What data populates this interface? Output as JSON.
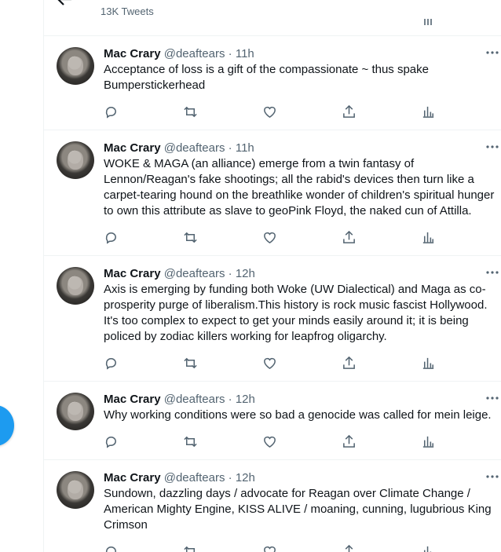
{
  "header": {
    "tweet_count": "13K Tweets"
  },
  "tweets": [
    {
      "name": "Mac Crary",
      "handle": "@deaftears",
      "separator": "·",
      "time": "11h",
      "text": "Acceptance of loss is a gift of the compassionate ~ thus spake\nBumperstickerhead"
    },
    {
      "name": "Mac Crary",
      "handle": "@deaftears",
      "separator": "·",
      "time": "11h",
      "text": "WOKE & MAGA (an alliance) emerge from a twin fantasy of\nLennon/Reagan's fake shootings; all the rabid's devices then turn like a\ncarpet-tearing hound on the breathlike wonder of children's spiritual hunger\nto own this attribute as slave to geoPink Floyd, the naked cun of Attilla."
    },
    {
      "name": "Mac Crary",
      "handle": "@deaftears",
      "separator": "·",
      "time": "12h",
      "text": "Axis is emerging by funding both Woke (UW Dialectical) and Maga as co-\nprosperity purge of liberalism.This history is rock music fascist Hollywood.\nIt's too complex to expect to get your minds easily around it; it is being\npoliced by zodiac killers working for leapfrog oligarchy."
    },
    {
      "name": "Mac Crary",
      "handle": "@deaftears",
      "separator": "·",
      "time": "12h",
      "text": "Why working conditions were so bad a genocide was called for mein leige."
    },
    {
      "name": "Mac Crary",
      "handle": "@deaftears",
      "separator": "·",
      "time": "12h",
      "text": "Sundown, dazzling days / advocate for Reagan over Climate Change /\nAmerican Mighty Engine, KISS ALIVE / moaning, cunning, lugubrious King\nCrimson"
    }
  ],
  "icons": {
    "reply": "reply-icon",
    "retweet": "retweet-icon",
    "like": "like-icon",
    "share": "share-icon",
    "analytics": "analytics-icon",
    "more": "more-icon"
  },
  "colors": {
    "accent": "#1d9bf0",
    "muted": "#536471",
    "text": "#0f1419",
    "border": "#eff3f4"
  }
}
